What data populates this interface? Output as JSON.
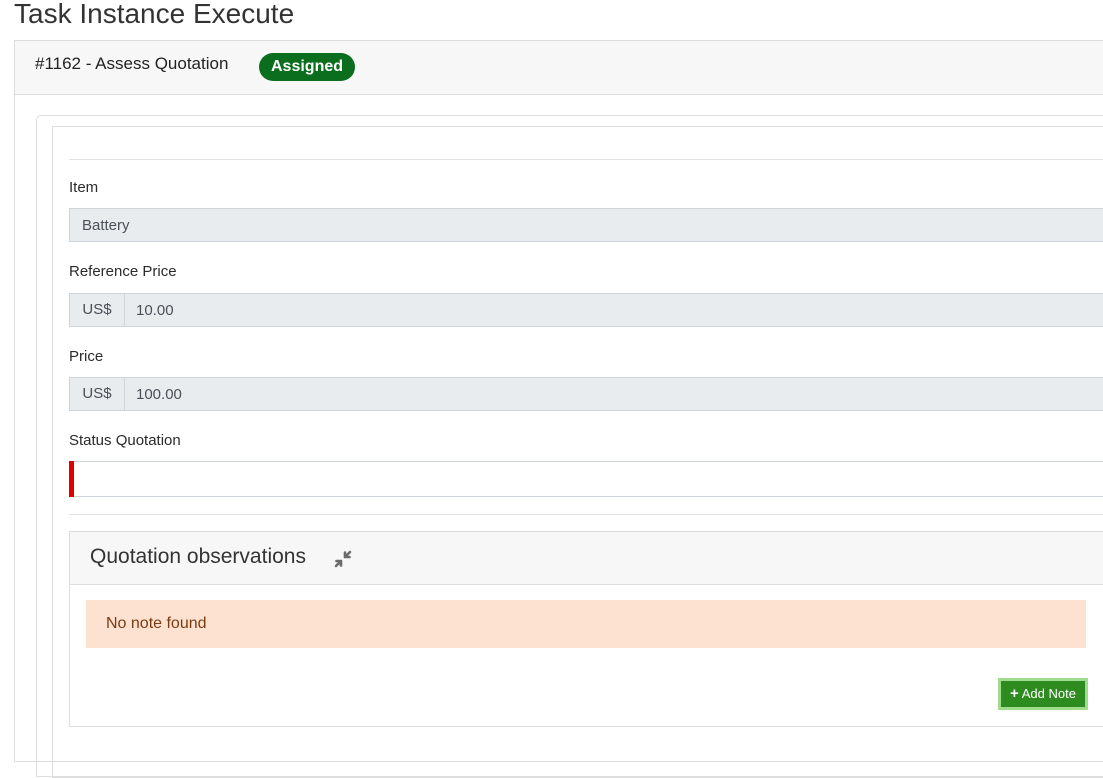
{
  "page": {
    "title": "Task Instance Execute"
  },
  "task": {
    "heading": "#1162 - Assess Quotation",
    "status_badge": "Assigned",
    "status_color": "#0b6e1f"
  },
  "form": {
    "item": {
      "label": "Item",
      "value": "Battery"
    },
    "reference_price": {
      "label": "Reference Price",
      "currency": "US$",
      "value": "10.00"
    },
    "price": {
      "label": "Price",
      "currency": "US$",
      "value": "100.00"
    },
    "status_quotation": {
      "label": "Status Quotation",
      "selected": "",
      "required_marker_color": "#e00000"
    }
  },
  "observations": {
    "title": "Quotation observations",
    "collapse_icon": "compress-icon",
    "empty_message": "No note found",
    "add_button_label": "Add Note",
    "add_button_icon": "plus-icon"
  }
}
